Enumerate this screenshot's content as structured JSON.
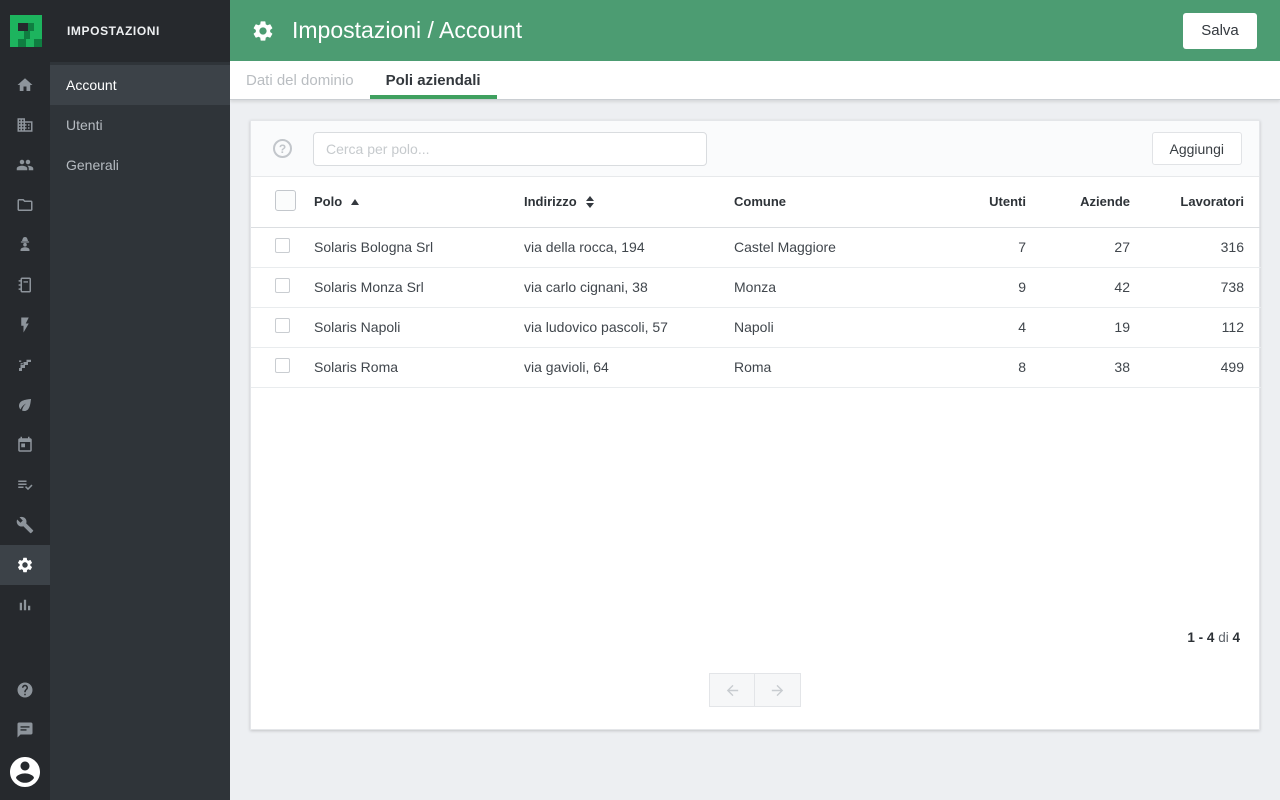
{
  "brand": {
    "app_label": "IMPOSTAZIONI"
  },
  "sidebar": {
    "items": [
      {
        "label": "Account",
        "active": true
      },
      {
        "label": "Utenti",
        "active": false
      },
      {
        "label": "Generali",
        "active": false
      }
    ],
    "rail_icons": [
      "home",
      "building",
      "people",
      "folder",
      "worker",
      "notebook",
      "lightning",
      "stairs",
      "leaf",
      "calendar",
      "checklist",
      "wrench",
      "settings",
      "bar-chart"
    ],
    "rail_bottom_icons": [
      "help",
      "feedback",
      "avatar"
    ],
    "active_rail_icon": "settings"
  },
  "header": {
    "title": "Impostazioni / Account",
    "save_label": "Salva"
  },
  "tabs": [
    {
      "label": "Dati del dominio",
      "active": false
    },
    {
      "label": "Poli aziendali",
      "active": true
    }
  ],
  "toolbar": {
    "search_placeholder": "Cerca per polo...",
    "add_label": "Aggiungi"
  },
  "table": {
    "columns": [
      "Polo",
      "Indirizzo",
      "Comune",
      "Utenti",
      "Aziende",
      "Lavoratori"
    ],
    "sort": {
      "column": "Polo",
      "direction": "asc"
    },
    "rows": [
      {
        "polo": "Solaris Bologna Srl",
        "indirizzo": "via della rocca, 194",
        "comune": "Castel Maggiore",
        "utenti": "7",
        "aziende": "27",
        "lavoratori": "316"
      },
      {
        "polo": "Solaris Monza Srl",
        "indirizzo": "via carlo cignani, 38",
        "comune": "Monza",
        "utenti": "9",
        "aziende": "42",
        "lavoratori": "738"
      },
      {
        "polo": "Solaris Napoli",
        "indirizzo": "via ludovico pascoli, 57",
        "comune": "Napoli",
        "utenti": "4",
        "aziende": "19",
        "lavoratori": "112"
      },
      {
        "polo": "Solaris Roma",
        "indirizzo": "via gavioli, 64",
        "comune": "Roma",
        "utenti": "8",
        "aziende": "38",
        "lavoratori": "499"
      }
    ]
  },
  "pagination": {
    "range": "1 - 4",
    "separator": "di",
    "total": "4"
  },
  "colors": {
    "header_green": "#4c9c72",
    "tab_underline": "#3fa05f",
    "logo_bright": "#1db45e",
    "logo_dark": "#0f7e41",
    "rail_bg": "#26292d",
    "panel_bg": "#2f3439",
    "active_item_bg": "#3c4248"
  }
}
